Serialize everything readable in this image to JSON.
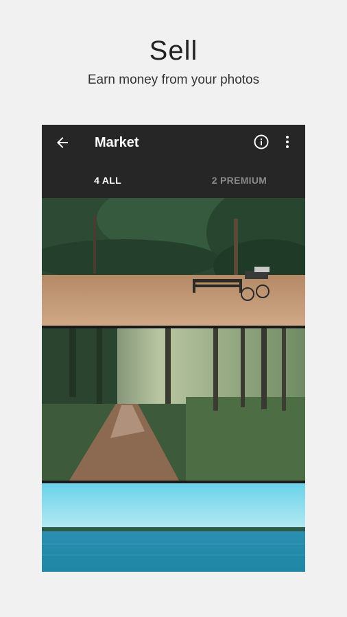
{
  "hero": {
    "title": "Sell",
    "subtitle": "Earn money from your photos"
  },
  "appbar": {
    "title": "Market",
    "back_icon": "arrow-left-icon",
    "info_icon": "info-icon",
    "more_icon": "more-vert-icon"
  },
  "tabs": [
    {
      "label": "4 ALL",
      "selected": true
    },
    {
      "label": "2 PREMIUM",
      "selected": false
    }
  ],
  "photos": [
    {
      "subject": "park-bench-with-bicycle"
    },
    {
      "subject": "forest-dirt-path"
    },
    {
      "subject": "lake-horizon"
    }
  ],
  "colors": {
    "background": "#f1f1f1",
    "appbar": "#262626",
    "tab_active": "#ffffff",
    "tab_inactive": "#8a8a8a"
  }
}
